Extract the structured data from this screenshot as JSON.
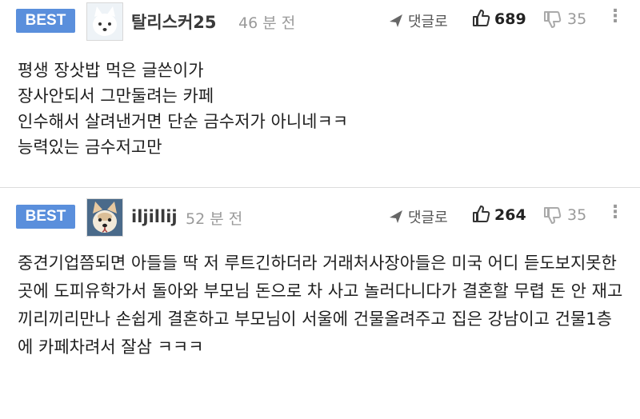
{
  "comments": [
    {
      "badge": "BEST",
      "nickname": "탈리스커25",
      "time": "46 분 전",
      "reply_label": "댓글로",
      "likes": "689",
      "dislikes": "35",
      "text": "평생 장삿밥 먹은 글쓴이가\n장사안되서 그만둘려는 카페\n인수해서 살려낸거면 단순 금수저가 아니네ㅋㅋ\n능력있는 금수저고만",
      "avatar_icon": "dog-avatar-icon"
    },
    {
      "badge": "BEST",
      "nickname": "iljillij",
      "time": "52 분 전",
      "reply_label": "댓글로",
      "likes": "264",
      "dislikes": "35",
      "text": "중견기업쯤되면 아들들 딱 저 루트긴하더라 거래처사장아들은 미국 어디 듣도보지못한 곳에 도피유학가서 돌아와 부모님 돈으로 차 사고 놀러다니다가 결혼할 무렵 돈 안 재고 끼리끼리만나 손쉽게 결혼하고 부모님이 서울에 건물올려주고 집은 강남이고 건물1층에 카페차려서 잘삼 ㅋㅋㅋ",
      "avatar_icon": "dog-avatar-icon"
    }
  ],
  "colors": {
    "badge": "#5a8fdc",
    "divider": "#dcdcdc",
    "muted": "#9a9a9a"
  },
  "icons": {
    "reply": "paper-plane-icon",
    "like": "thumbs-up-icon",
    "dislike": "thumbs-down-icon",
    "more": "more-options-icon"
  }
}
